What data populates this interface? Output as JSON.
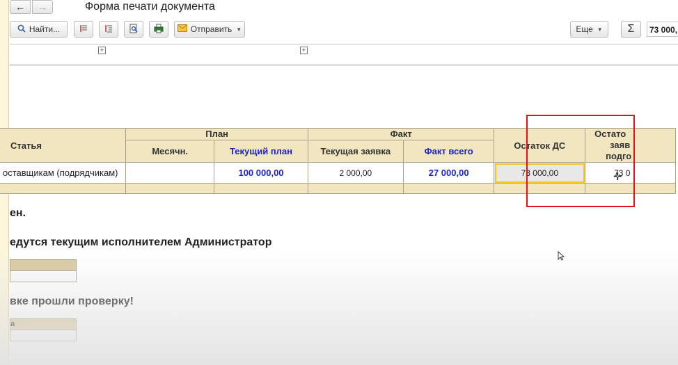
{
  "window": {
    "title": "Форма печати документа"
  },
  "toolbar": {
    "find_label": "Найти...",
    "send_label": "Отправить",
    "more_label": "Еще",
    "sum_symbol": "Σ",
    "sum_value": "73 000,"
  },
  "table": {
    "col_article": "Статья",
    "group_plan": "План",
    "group_fact": "Факт",
    "col_monthly": "Месячн.",
    "col_current_plan": "Текущий план",
    "col_current_request": "Текущая заявка",
    "col_fact_total": "Факт всего",
    "col_balance": "Остаток ДС",
    "col_balance_next_line1": "Остато",
    "col_balance_next_line2": "заяв",
    "col_balance_next_line3": "подго",
    "row": {
      "article": "оставщикам (подрядчикам)",
      "monthly": "",
      "current_plan": "100 000,00",
      "current_request": "2 000,00",
      "fact_total": "27 000,00",
      "balance": "73 000,00",
      "balance_next": "73 0"
    }
  },
  "messages": {
    "line1": "ен.",
    "line2": "едутся текущим исполнителем Администратор",
    "line3": "вке прошли проверку!",
    "mini_header": "а"
  },
  "icons": {
    "back": "arrow-left-icon",
    "forward": "arrow-right-icon",
    "search": "search-icon",
    "envelope": "envelope-icon"
  },
  "colors": {
    "header_fill": "#f2e6c1",
    "blue_text": "#1c24c6",
    "highlight_box": "#e5121c",
    "selection": "#f3c72b"
  }
}
